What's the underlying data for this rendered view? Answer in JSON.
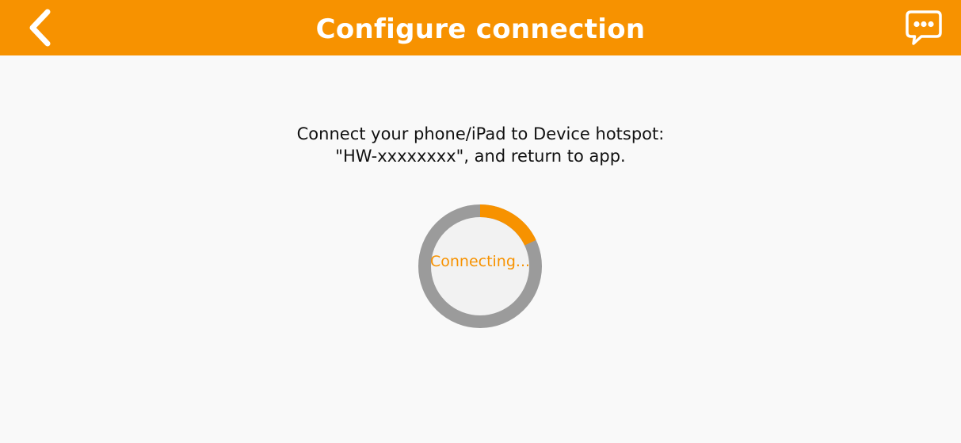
{
  "header": {
    "title": "Configure connection",
    "background_color": "#f79200",
    "back_icon": "chevron-left-icon",
    "chat_icon": "chat-bubble-icon"
  },
  "instructions": {
    "line1": "Connect your phone/iPad to Device hotspot:",
    "line2": "\"HW-xxxxxxxx\", and return to app."
  },
  "progress": {
    "label": "Connecting...",
    "fraction": 0.18,
    "accent_color": "#f79200",
    "track_color": "#9b9b9b"
  }
}
